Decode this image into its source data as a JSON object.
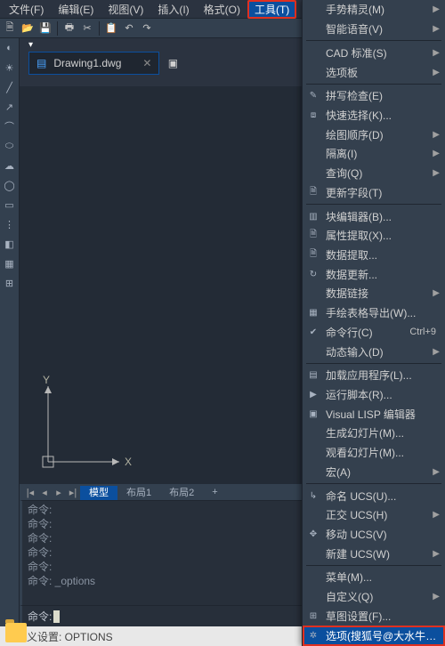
{
  "menubar": [
    {
      "label": "文件(F)",
      "active": false
    },
    {
      "label": "编辑(E)",
      "active": false
    },
    {
      "label": "视图(V)",
      "active": false
    },
    {
      "label": "插入(I)",
      "active": false
    },
    {
      "label": "格式(O)",
      "active": false
    },
    {
      "label": "工具(T)",
      "active": true
    }
  ],
  "doc": {
    "name": "Drawing1.dwg"
  },
  "layout": {
    "tabs": [
      {
        "label": "模型",
        "active": true
      },
      {
        "label": "布局1",
        "active": false
      },
      {
        "label": "布局2",
        "active": false
      }
    ]
  },
  "axes": {
    "x": "X",
    "y": "Y"
  },
  "cmd": {
    "log": [
      "命令:",
      "命令:",
      "命令:",
      "命令:",
      "命令:",
      "命令: _options"
    ],
    "prompt": "命令:"
  },
  "status": "自定义设置: OPTIONS",
  "menu": [
    {
      "t": "item",
      "label": "手势精灵(M)",
      "arrow": true
    },
    {
      "t": "item",
      "label": "智能语音(V)",
      "arrow": true
    },
    {
      "t": "sep"
    },
    {
      "t": "item",
      "label": "CAD 标准(S)",
      "arrow": true
    },
    {
      "t": "item",
      "label": "选项板",
      "arrow": true
    },
    {
      "t": "sep"
    },
    {
      "t": "item",
      "label": "拼写检查(E)",
      "icon": "✎"
    },
    {
      "t": "item",
      "label": "快速选择(K)...",
      "icon": "⧈"
    },
    {
      "t": "item",
      "label": "绘图顺序(D)",
      "arrow": true
    },
    {
      "t": "item",
      "label": "隔离(I)",
      "arrow": true
    },
    {
      "t": "item",
      "label": "查询(Q)",
      "arrow": true
    },
    {
      "t": "item",
      "label": "更新字段(T)",
      "icon": "🗎"
    },
    {
      "t": "sep"
    },
    {
      "t": "item",
      "label": "块编辑器(B)...",
      "icon": "▥"
    },
    {
      "t": "item",
      "label": "属性提取(X)...",
      "icon": "🗎"
    },
    {
      "t": "item",
      "label": "数据提取...",
      "icon": "🗎"
    },
    {
      "t": "item",
      "label": "数据更新...",
      "icon": "↻"
    },
    {
      "t": "item",
      "label": "数据链接",
      "arrow": true
    },
    {
      "t": "item",
      "label": "手绘表格导出(W)...",
      "icon": "▦"
    },
    {
      "t": "item",
      "label": "命令行(C)",
      "icon": "✔",
      "shortcut": "Ctrl+9"
    },
    {
      "t": "item",
      "label": "动态输入(D)",
      "arrow": true
    },
    {
      "t": "sep"
    },
    {
      "t": "item",
      "label": "加载应用程序(L)...",
      "icon": "▤"
    },
    {
      "t": "item",
      "label": "运行脚本(R)...",
      "icon": "▶"
    },
    {
      "t": "item",
      "label": "Visual LISP 编辑器",
      "icon": "▣"
    },
    {
      "t": "item",
      "label": "生成幻灯片(M)...",
      "arrow": false
    },
    {
      "t": "item",
      "label": "观看幻灯片(M)...",
      "arrow": false
    },
    {
      "t": "item",
      "label": "宏(A)",
      "arrow": true
    },
    {
      "t": "sep"
    },
    {
      "t": "item",
      "label": "命名 UCS(U)...",
      "icon": "↳"
    },
    {
      "t": "item",
      "label": "正交 UCS(H)",
      "arrow": true
    },
    {
      "t": "item",
      "label": "移动 UCS(V)",
      "icon": "✥"
    },
    {
      "t": "item",
      "label": "新建 UCS(W)",
      "arrow": true
    },
    {
      "t": "sep"
    },
    {
      "t": "item",
      "label": "菜单(M)...",
      "arrow": false
    },
    {
      "t": "item",
      "label": "自定义(Q)",
      "arrow": true
    },
    {
      "t": "item",
      "label": "草图设置(F)...",
      "icon": "⊞"
    },
    {
      "t": "item",
      "label": "选项(搜狐号@大水牛测绘",
      "icon": "✲",
      "hl": true
    }
  ],
  "left_tools": [
    "◐",
    "☀",
    "╱",
    "↗",
    "⌒",
    "⬭",
    "☁",
    "◯",
    "▭",
    "⋮",
    "◧",
    "▦",
    "⊞"
  ],
  "toolbar_icons": [
    "🗎",
    "📂",
    "💾",
    "🖶",
    "✂",
    "📋",
    "↶",
    "↷"
  ]
}
